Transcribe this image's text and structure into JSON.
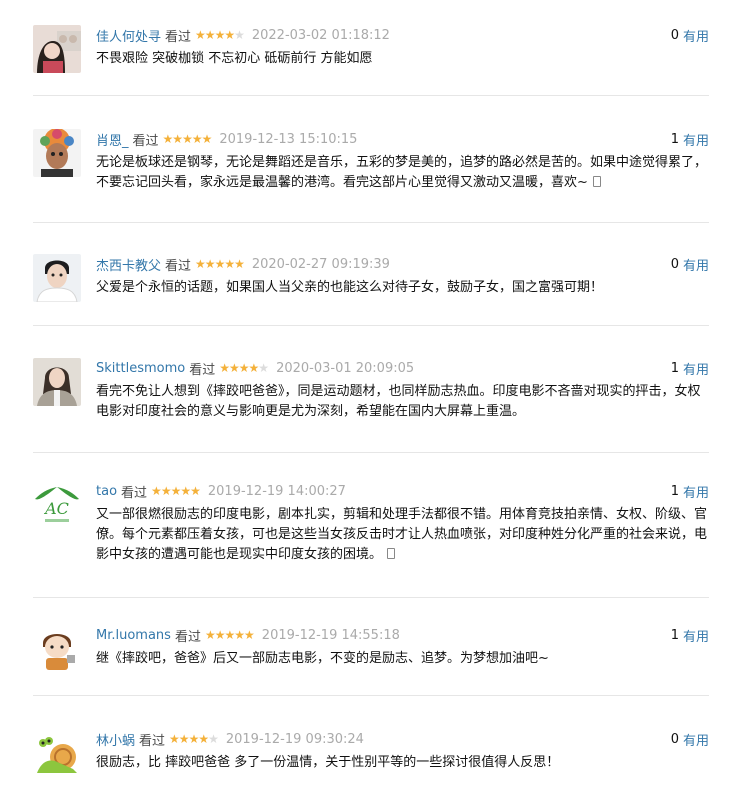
{
  "comments": [
    {
      "user": "佳人何处寻",
      "watched": "看过",
      "rating": 4,
      "time": "2022-03-02 01:18:12",
      "votes": "0",
      "vote_label": "有用",
      "text": "不畏艰险 突破枷锁 不忘初心 砥砺前行 方能如愿",
      "phone_icon": false
    },
    {
      "user": "肖恩_",
      "watched": "看过",
      "rating": 5,
      "time": "2019-12-13 15:10:15",
      "votes": "1",
      "vote_label": "有用",
      "text": "无论是板球还是钢琴，无论是舞蹈还是音乐，五彩的梦是美的，追梦的路必然是苦的。如果中途觉得累了，不要忘记回头看，家永远是最温馨的港湾。看完这部片心里觉得又激动又温暖，喜欢~",
      "phone_icon": true
    },
    {
      "user": "杰西卡教父",
      "watched": "看过",
      "rating": 5,
      "time": "2020-02-27 09:19:39",
      "votes": "0",
      "vote_label": "有用",
      "text": "父爱是个永恒的话题，如果国人当父亲的也能这么对待子女，鼓励子女，国之富强可期！",
      "phone_icon": false
    },
    {
      "user": "Skittlesmomo",
      "watched": "看过",
      "rating": 4,
      "time": "2020-03-01 20:09:05",
      "votes": "1",
      "vote_label": "有用",
      "text": "看完不免让人想到《摔跤吧爸爸》，同是运动题材，也同样励志热血。印度电影不吝啬对现实的抨击，女权电影对印度社会的意义与影响更是尤为深刻，希望能在国内大屏幕上重温。",
      "phone_icon": false
    },
    {
      "user": "tao",
      "watched": "看过",
      "rating": 5,
      "time": "2019-12-19 14:00:27",
      "votes": "1",
      "vote_label": "有用",
      "text": "又一部很燃很励志的印度电影，剧本扎实，剪辑和处理手法都很不错。用体育竞技拍亲情、女权、阶级、官僚。每个元素都压着女孩，可也是这些当女孩反击时才让人热血喷张，对印度种姓分化严重的社会来说，电影中女孩的遭遇可能也是现实中印度女孩的困境。",
      "phone_icon": true
    },
    {
      "user": "Mr.luomans",
      "watched": "看过",
      "rating": 5,
      "time": "2019-12-19 14:55:18",
      "votes": "1",
      "vote_label": "有用",
      "text": "继《摔跤吧，爸爸》后又一部励志电影，不变的是励志、追梦。为梦想加油吧~",
      "phone_icon": false
    },
    {
      "user": "林小蜗",
      "watched": "看过",
      "rating": 4,
      "time": "2019-12-19 09:30:24",
      "votes": "0",
      "vote_label": "有用",
      "text": "很励志，比 摔跤吧爸爸 多了一份温情，关于性别平等的一些探讨很值得人反思！",
      "phone_icon": false
    }
  ],
  "colors": {
    "link": "#3377aa",
    "star_on": "#f4b13a",
    "star_off": "#dcdcdc",
    "time": "#aaaaaa",
    "divider": "#e6e6e6"
  },
  "icons": {
    "star": "star-icon",
    "phone": "phone-icon"
  }
}
